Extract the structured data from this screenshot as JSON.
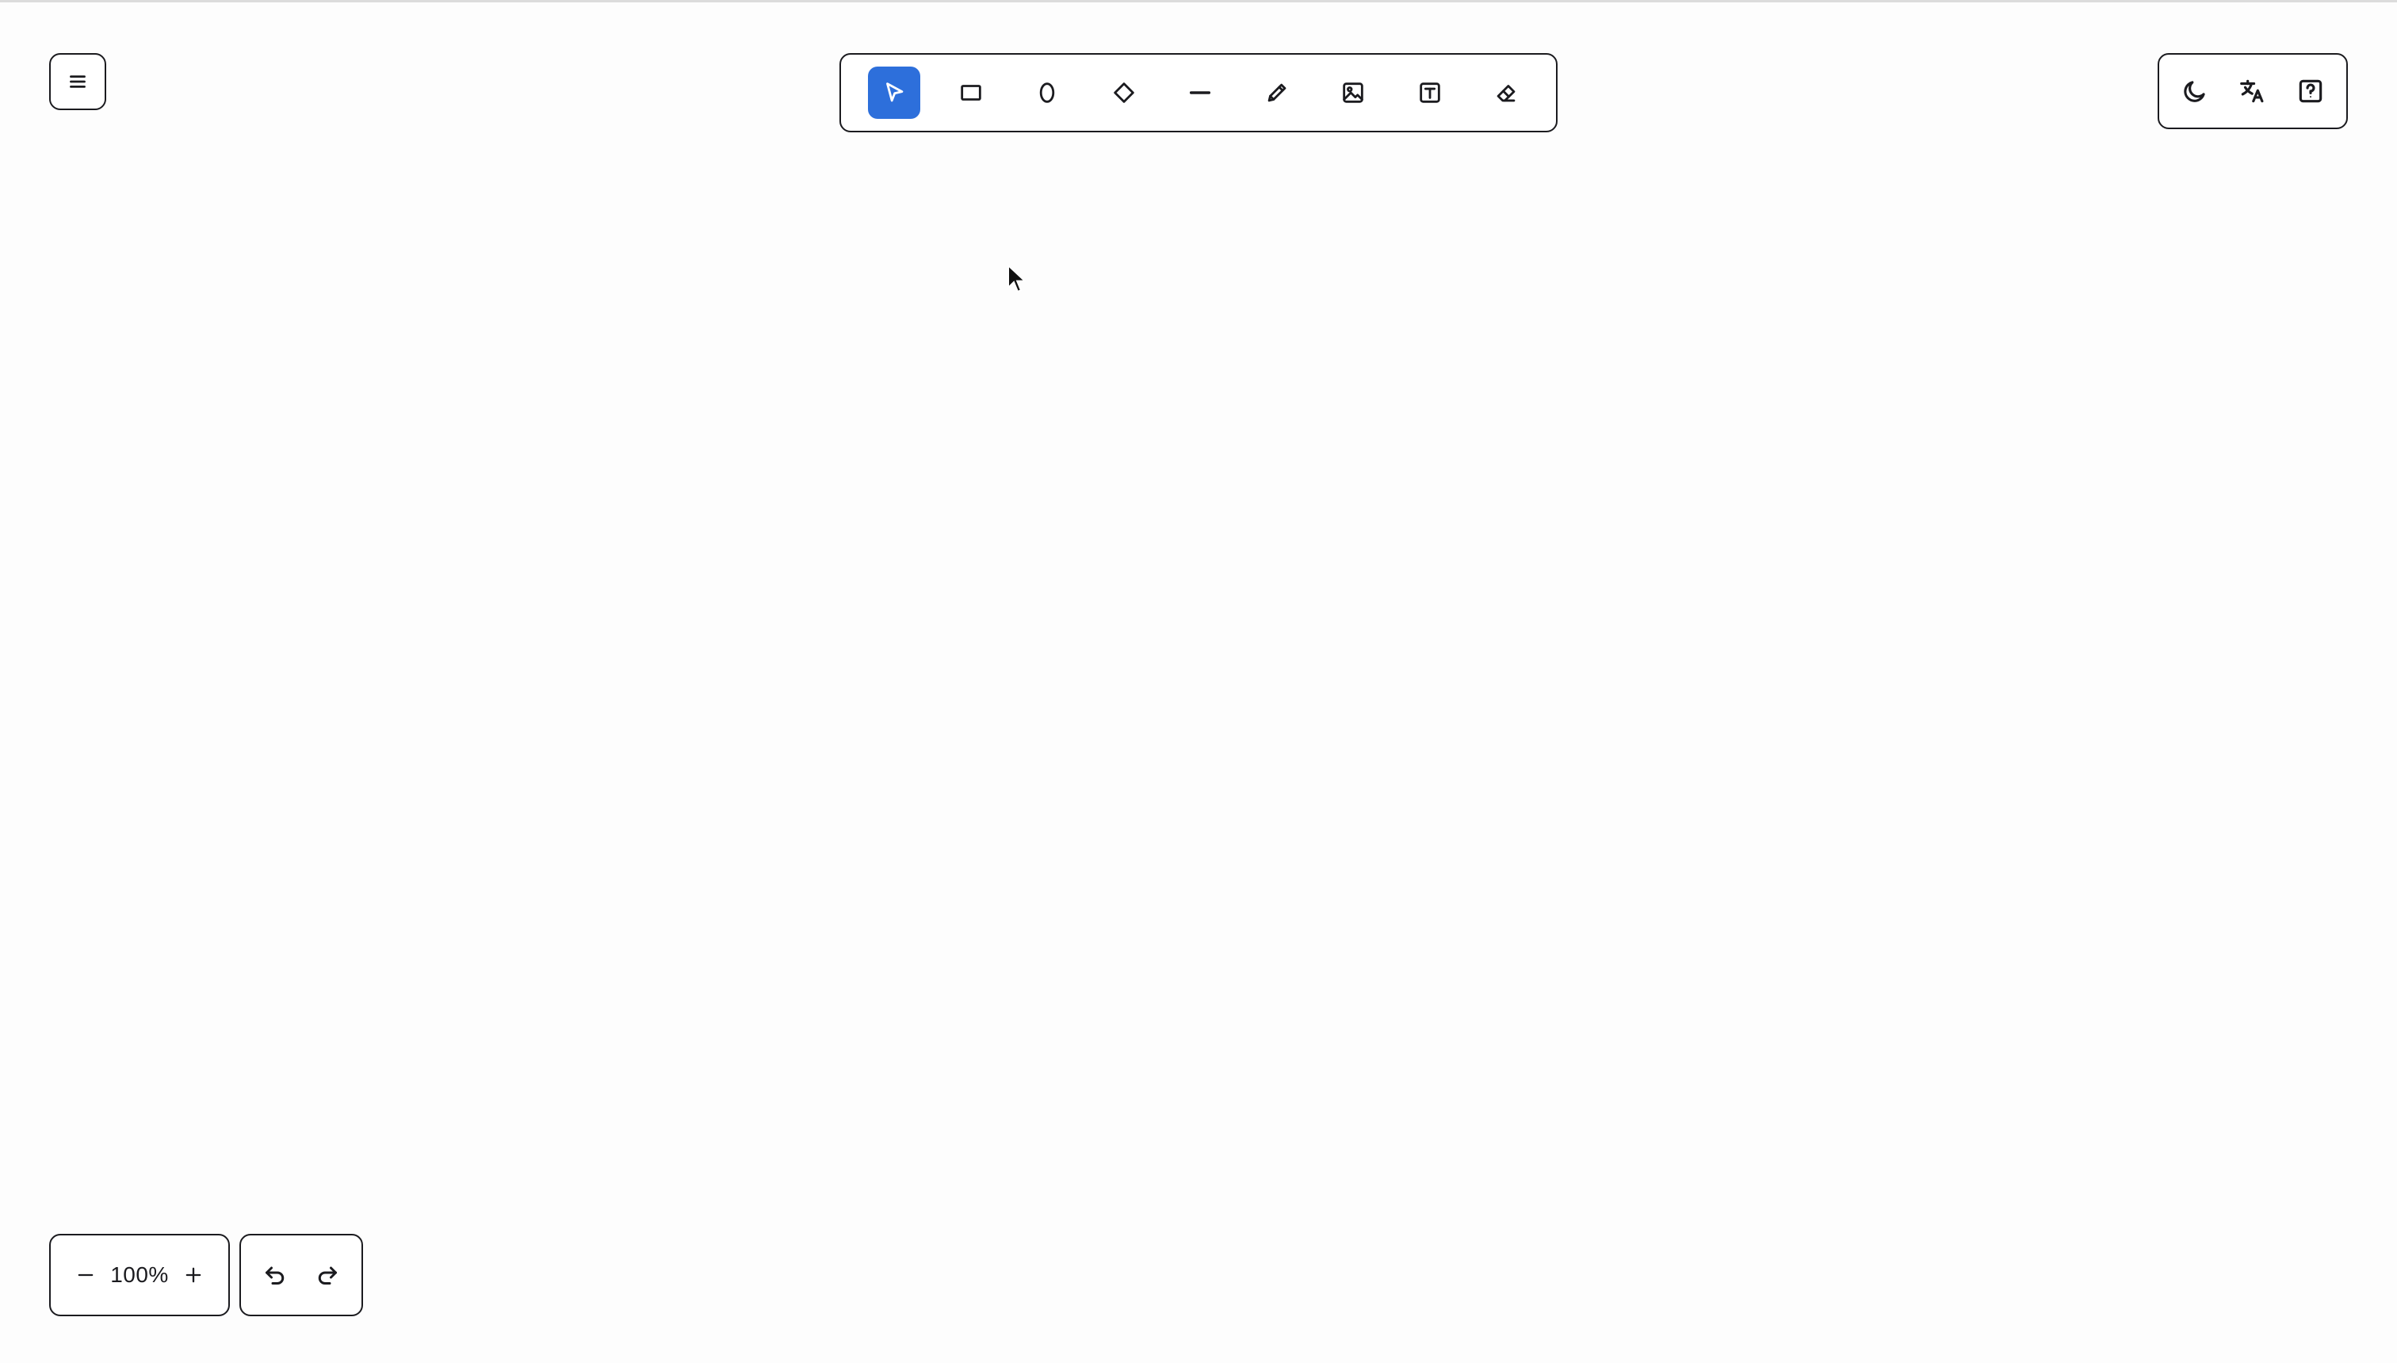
{
  "app": {
    "accent_color": "#2d6fdb",
    "canvas_background": "#fdfdfd"
  },
  "menu": {
    "icon": "hamburger-menu-icon"
  },
  "toolbar": {
    "active_tool": "select",
    "tools": [
      {
        "id": "select",
        "icon": "pointer-arrow-icon"
      },
      {
        "id": "rectangle",
        "icon": "rectangle-icon"
      },
      {
        "id": "ellipse",
        "icon": "ellipse-icon"
      },
      {
        "id": "diamond",
        "icon": "diamond-icon"
      },
      {
        "id": "line",
        "icon": "line-icon"
      },
      {
        "id": "pencil",
        "icon": "pencil-icon"
      },
      {
        "id": "image",
        "icon": "image-icon"
      },
      {
        "id": "text",
        "icon": "text-box-icon"
      },
      {
        "id": "eraser",
        "icon": "eraser-icon"
      }
    ]
  },
  "top_right": {
    "theme_icon": "moon-icon",
    "language_icon": "translate-icon",
    "help_icon": "help-question-icon"
  },
  "zoom": {
    "level": "100%",
    "zoom_out_icon": "minus-icon",
    "zoom_in_icon": "plus-icon"
  },
  "history": {
    "undo_icon": "undo-icon",
    "redo_icon": "redo-icon"
  }
}
